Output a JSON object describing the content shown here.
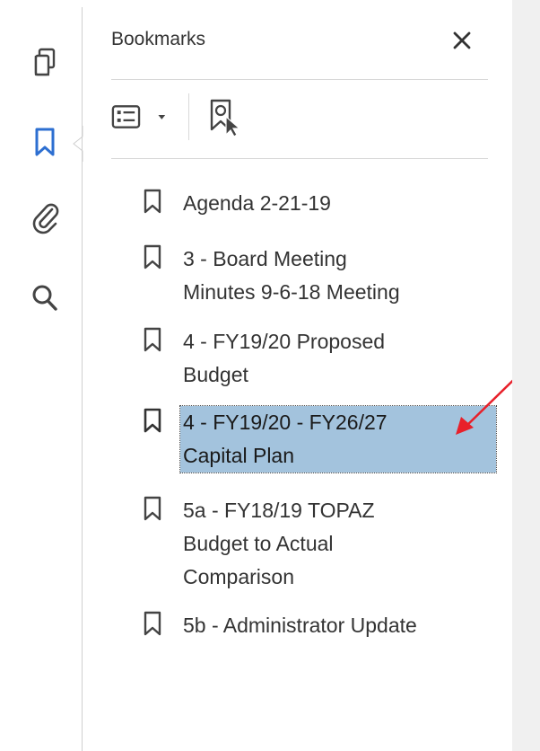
{
  "panel": {
    "title": "Bookmarks",
    "close_icon": "close-icon"
  },
  "rail": {
    "icons": [
      "pages-icon",
      "bookmark-icon",
      "attachment-icon",
      "search-icon"
    ],
    "active": "bookmark-icon",
    "accent_color": "#2d6fd1"
  },
  "toolbar": {
    "options_icon": "options-list-icon",
    "find_icon": "find-current-bookmark-icon"
  },
  "bookmarks": [
    {
      "label": "Agenda 2-21-19",
      "selected": false
    },
    {
      "label": "3 - Board Meeting\nMinutes 9-6-18 Meeting",
      "selected": false
    },
    {
      "label": "4 - FY19/20 Proposed\nBudget",
      "selected": false
    },
    {
      "label": "4 - FY19/20 - FY26/27\nCapital Plan",
      "selected": true
    },
    {
      "label": "5a - FY18/19 TOPAZ\nBudget to Actual\nComparison",
      "selected": false
    },
    {
      "label": "5b - Administrator Update",
      "selected": false
    }
  ],
  "colors": {
    "selection": "#a3c3dd",
    "annotation_arrow": "#e8202a"
  }
}
